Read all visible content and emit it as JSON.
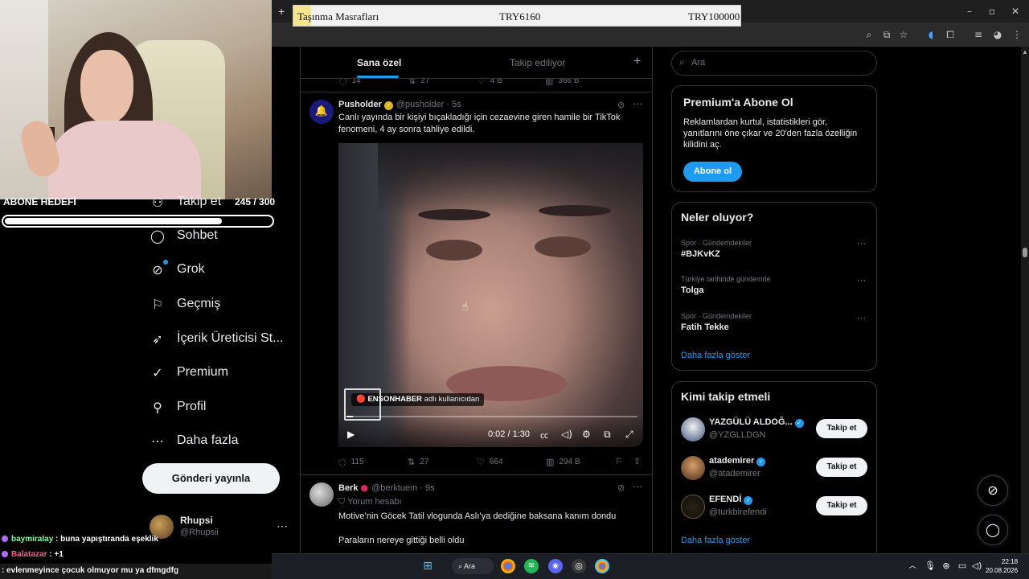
{
  "banner": {
    "label": "Taşınma Masrafları",
    "current": "TRY6160",
    "goal": "TRY100000"
  },
  "stream": {
    "goal_label": "ABONE HEDEFİ",
    "goal_count": "245 / 300",
    "goal_progress": 0.817,
    "chat": [
      {
        "user": "baymiralay",
        "text": ": buna yapıştıranda eşeklik"
      },
      {
        "user": "Balatazar",
        "text": ": +1"
      },
      {
        "user": "",
        "text": ": evlenmeyince çocuk olmuyor mu ya dfmgdfg"
      }
    ]
  },
  "nav": {
    "items": [
      {
        "label": "Takip et",
        "icon": "person-plus-icon"
      },
      {
        "label": "Sohbet",
        "icon": "chat-bubble-icon"
      },
      {
        "label": "Grok",
        "icon": "grok-icon"
      },
      {
        "label": "Geçmiş",
        "icon": "bookmark-icon"
      },
      {
        "label": "İçerik Üreticisi St...",
        "icon": "rocket-icon"
      },
      {
        "label": "Premium",
        "icon": "verified-badge-icon"
      },
      {
        "label": "Profil",
        "icon": "person-icon"
      },
      {
        "label": "Daha fazla",
        "icon": "more-circle-icon"
      }
    ],
    "post_button": "Gönderi yayınla",
    "account": {
      "name": "Rhupsi",
      "handle": "@Rhupsii"
    }
  },
  "timeline": {
    "tabs": [
      {
        "label": "Sana özel",
        "active": true
      },
      {
        "label": "Takip ediliyor",
        "active": false
      }
    ],
    "prev_actions": {
      "replies": "14",
      "reposts": "27",
      "likes": "4 B",
      "views": "366 B"
    },
    "tweets": [
      {
        "name": "Pusholder",
        "handle": "@pusholder",
        "time": "· 5s",
        "text": "Canlı yayında bir kişiyi bıçakladığı için cezaevine giren hamile bir TikTok fenomeni, 4 ay sonra tahliye edildi.",
        "media": {
          "source_name": "ENSONHABER",
          "source_suffix": "adlı kullanıcıdan",
          "time": "0:02 / 1:30",
          "progress": 0.022
        },
        "actions": {
          "replies": "115",
          "reposts": "27",
          "likes": "664",
          "views": "294 B"
        }
      },
      {
        "name": "Berk",
        "handle": "@berktuem",
        "time": "· 9s",
        "label": "Yorum hesabı",
        "text1": "Motive’nin Göcek Tatil vlogunda Aslı’ya dediğine baksana kanım dondu",
        "text2": "Paraların nereye gittiği belli oldu"
      }
    ]
  },
  "sidebar": {
    "search_placeholder": "Ara",
    "premium": {
      "title": "Premium'a Abone Ol",
      "text": "Reklamlardan kurtul, istatistikleri gör, yanıtlarını öne çıkar ve 20'den fazla özelliğin kilidini aç.",
      "button": "Abone ol"
    },
    "trends": {
      "title": "Neler oluyor?",
      "items": [
        {
          "category": "Spor · Gündemdekiler",
          "name": "#BJKvKZ"
        },
        {
          "category": "Türkiye tarihinde gündemde",
          "name": "Tolga"
        },
        {
          "category": "Spor · Gündemdekiler",
          "name": "Fatih Tekke"
        }
      ],
      "show_more": "Daha fazla göster"
    },
    "who_to_follow": {
      "title": "Kimi takip etmeli",
      "items": [
        {
          "name": "YAZGÜLÜ ALDOĞ...",
          "handle": "@YZGLLDGN",
          "button": "Takip et"
        },
        {
          "name": "atademirer",
          "handle": "@atademirer",
          "button": "Takip et"
        },
        {
          "name": "EFENDİ",
          "handle": "@turkbirefendi",
          "button": "Takip et"
        }
      ],
      "show_more": "Daha fazla göster"
    }
  },
  "taskbar": {
    "search": "Ara",
    "time": "22:18",
    "date": "20.08.2026"
  }
}
